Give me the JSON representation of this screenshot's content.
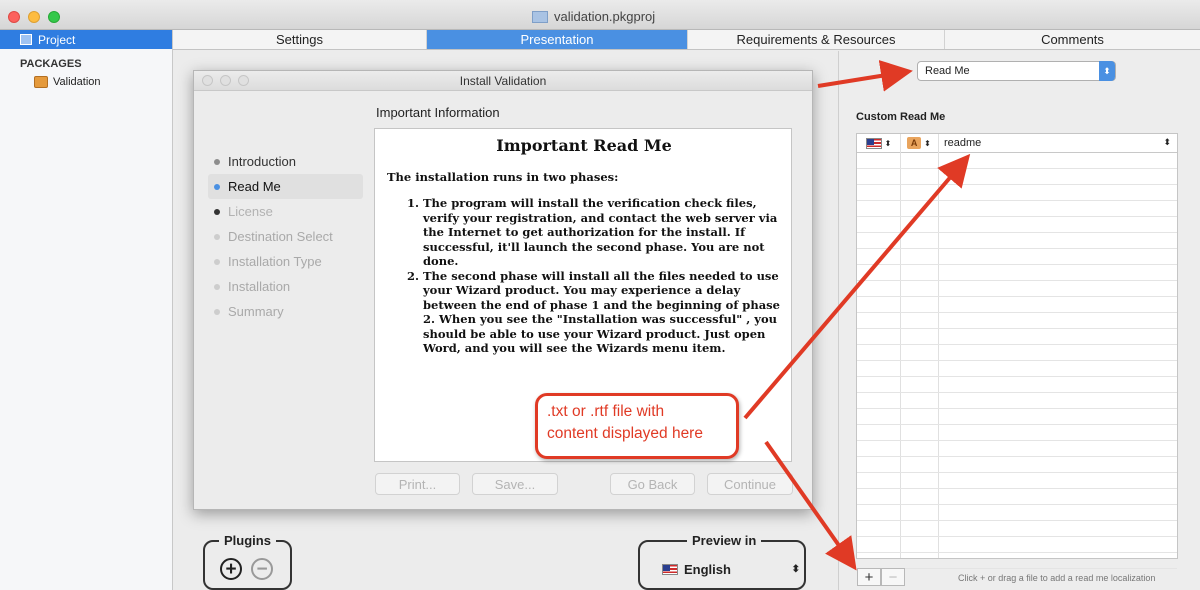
{
  "window": {
    "title": "validation.pkgproj"
  },
  "sidebar": {
    "project_label": "Project",
    "packages_header": "PACKAGES",
    "package_name": "Validation"
  },
  "tabs": [
    {
      "label": "Settings",
      "active": false
    },
    {
      "label": "Presentation",
      "active": true
    },
    {
      "label": "Requirements & Resources",
      "active": false
    },
    {
      "label": "Comments",
      "active": false
    }
  ],
  "installer": {
    "title": "Install Validation",
    "section_title": "Important Information",
    "steps": [
      {
        "label": "Introduction",
        "state": "normal"
      },
      {
        "label": "Read Me",
        "state": "active"
      },
      {
        "label": "License",
        "state": "strike"
      },
      {
        "label": "Destination Select",
        "state": "dim"
      },
      {
        "label": "Installation Type",
        "state": "dim"
      },
      {
        "label": "Installation",
        "state": "dim"
      },
      {
        "label": "Summary",
        "state": "dim"
      }
    ],
    "readme": {
      "heading": "Important Read Me",
      "lead": "The installation runs in two phases:",
      "items": [
        "The program will install the verification check files, verify your registration, and contact the web server via the Internet to get authorization for the install. If successful, it'll launch the second phase. You are not done.",
        "The second phase will install all the files needed to use your Wizard product. You may experience a delay between the end of phase 1 and the beginning of phase 2. When you see the \"Installation was successful\" , you should be able to use your Wizard product. Just open Word, and you will see the Wizards menu item."
      ]
    },
    "buttons": {
      "print": "Print...",
      "save": "Save...",
      "go_back": "Go Back",
      "continue": "Continue"
    }
  },
  "plugins": {
    "label": "Plugins",
    "add_symbol": "+",
    "remove_symbol": "−"
  },
  "preview": {
    "label": "Preview in",
    "language": "English"
  },
  "inspector": {
    "pane_popup_value": "Read Me",
    "custom_title": "Custom Read Me",
    "table": {
      "font_badge": "A",
      "first_row_file": "readme"
    },
    "add_symbol": "+",
    "remove_symbol": "−",
    "hint": "Click + or drag a file to add a read me localization"
  },
  "callout": {
    "line1": ".txt or .rtf file with",
    "line2": "content displayed here"
  },
  "colors": {
    "accent": "#4a90e2",
    "callout_red": "#e03a25"
  }
}
